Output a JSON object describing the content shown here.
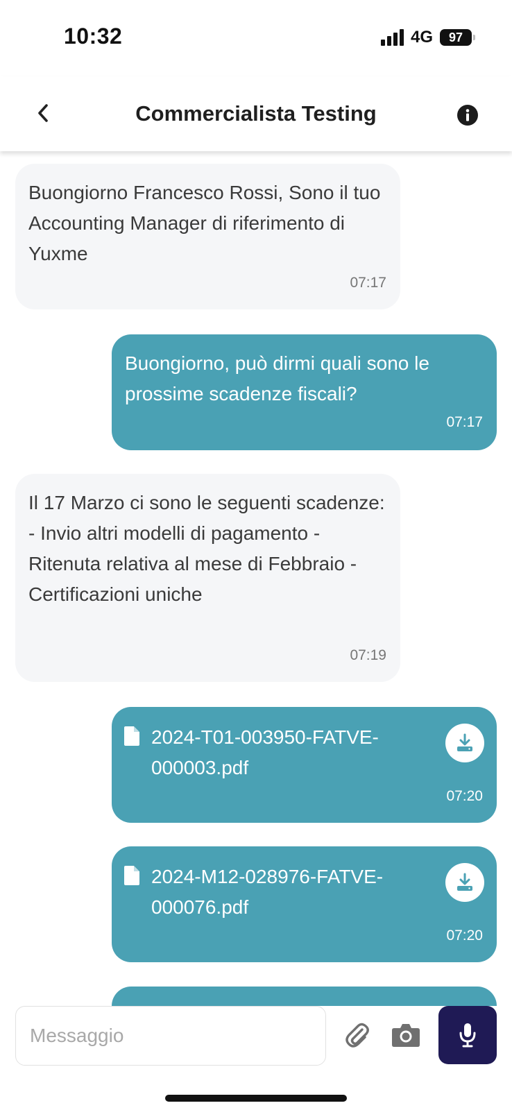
{
  "status_bar": {
    "time": "10:32",
    "network": "4G",
    "battery": "97"
  },
  "header": {
    "title": "Commercialista Testing"
  },
  "messages": [
    {
      "direction": "incoming",
      "text": "Buongiorno Francesco Rossi, Sono il tuo Accounting Manager di riferimento di Yuxme",
      "time": "07:17"
    },
    {
      "direction": "outgoing",
      "text": "Buongiorno, può dirmi quali sono le prossime scadenze fiscali?",
      "time": "07:17"
    },
    {
      "direction": "incoming",
      "text": "Il 17 Marzo ci sono le seguenti scadenze: - Invio altri modelli di pagamento - Ritenuta relativa al mese di Febbraio - Certificazioni uniche",
      "time": "07:19"
    },
    {
      "direction": "outgoing",
      "type": "file",
      "file_name": "2024-T01-003950-FATVE-000003.pdf",
      "time": "07:20"
    },
    {
      "direction": "outgoing",
      "type": "file",
      "file_name": "2024-M12-028976-FATVE-000076.pdf",
      "time": "07:20"
    }
  ],
  "composer": {
    "placeholder": "Messaggio",
    "value": ""
  },
  "icons": {
    "back": "chevron-left-icon",
    "info": "info-icon",
    "file": "file-icon",
    "download": "download-icon",
    "attach": "paperclip-icon",
    "camera": "camera-icon",
    "mic": "microphone-icon"
  },
  "colors": {
    "outgoing_bubble": "#4aa1b4",
    "incoming_bubble": "#f5f6f8",
    "mic_button": "#1f1a55"
  }
}
